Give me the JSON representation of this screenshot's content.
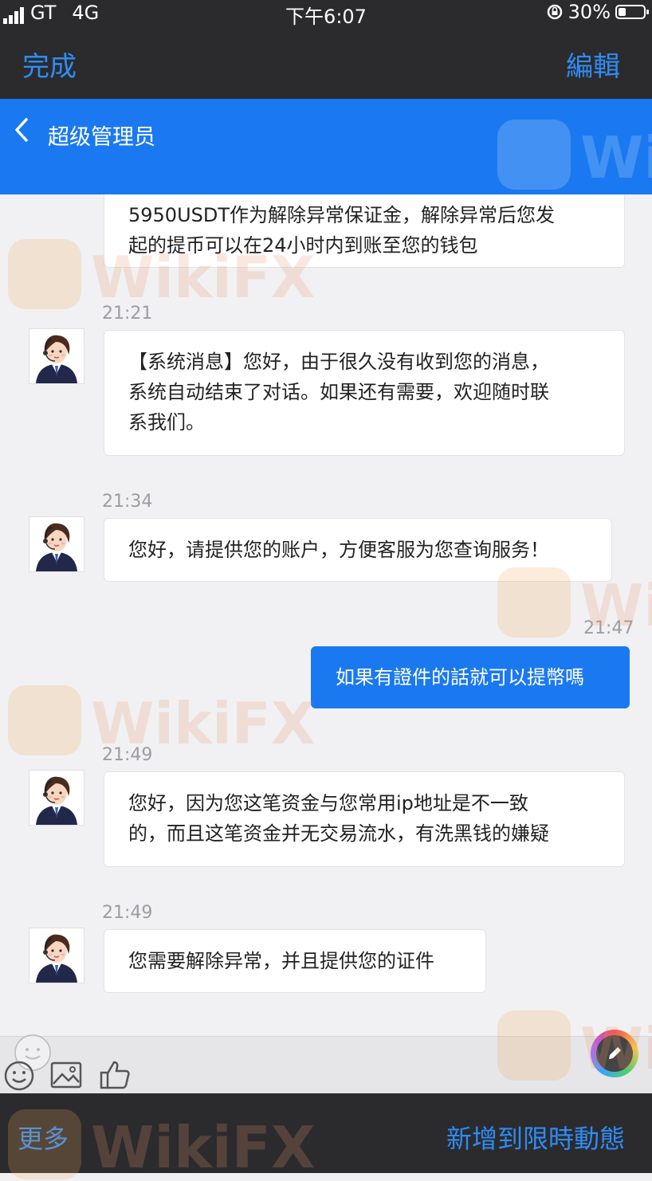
{
  "status_bar": {
    "carrier": "GT",
    "network": "4G",
    "time": "下午6:07",
    "battery": "30%",
    "battery_level": 0.3
  },
  "nav": {
    "done": "完成",
    "edit": "編輯"
  },
  "chat_header": {
    "back_icon": "chevron-left-icon",
    "title": "超级管理员"
  },
  "messages": [
    {
      "from": "agent",
      "time": "",
      "lines": [
        "5950USDT作为解除异常保证金，解除异常后您发",
        "起的提币可以在24小时内到账至您的钱包"
      ]
    },
    {
      "from": "agent",
      "time": "21:21",
      "lines": [
        "【系统消息】您好，由于很久没有收到您的消息，",
        "系统自动结束了对话。如果还有需要，欢迎随时联",
        "系我们。"
      ]
    },
    {
      "from": "agent",
      "time": "21:34",
      "lines": [
        "您好，请提供您的账户，方便客服为您查询服务！"
      ]
    },
    {
      "from": "me",
      "time": "21:47",
      "lines": [
        "如果有證件的話就可以提幣嗎"
      ]
    },
    {
      "from": "agent",
      "time": "21:49",
      "lines": [
        "您好，因为您这笔资金与您常用ip地址是不一致",
        "的，而且这笔资金并无交易流水，有洗黑钱的嫌疑"
      ]
    },
    {
      "from": "agent",
      "time": "21:49",
      "lines": [
        "您需要解除异常，并且提供您的证件"
      ]
    }
  ],
  "input_bar": {
    "icons": [
      "emoji-icon",
      "image-icon",
      "thumbs-up-icon",
      "edit-icon"
    ]
  },
  "bottom_bar": {
    "more": "更多",
    "add_to_moments": "新增到限時動態"
  },
  "watermark": {
    "text": "WikiFX"
  },
  "colors": {
    "accent": "#1a79f0",
    "link": "#2f8cf5",
    "dark_bar": "#2b2b2d"
  }
}
